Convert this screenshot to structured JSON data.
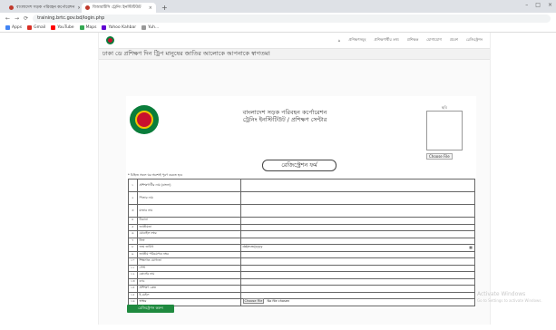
{
  "browser": {
    "tabs": [
      {
        "label": "বাংলাদেশ সড়ক পরিবহন কর্পোরেশন",
        "active": false
      },
      {
        "label": "বিআরটিসি ট্রেনিং ইনস্টিটিউট",
        "active": true
      }
    ],
    "new_tab": "+",
    "window_controls": [
      "–",
      "□",
      "×"
    ],
    "nav_buttons": [
      "←",
      "→",
      "⟳"
    ],
    "url": "training.brtc.gov.bd/login.php",
    "bookmarks": [
      {
        "label": "Apps",
        "icon": "apps-icon",
        "color": "#4285f4"
      },
      {
        "label": "Gmail",
        "icon": "gmail-icon",
        "color": "#d93025"
      },
      {
        "label": "YouTube",
        "icon": "youtube-icon",
        "color": "#ff0000"
      },
      {
        "label": "Maps",
        "icon": "maps-icon",
        "color": "#34a853"
      },
      {
        "label": "Yahoo Kahbar",
        "icon": "yahoo-icon",
        "color": "#6001d2"
      },
      {
        "label": "Yuh...",
        "icon": "bookmark-icon",
        "color": "#999999"
      }
    ]
  },
  "site": {
    "nav_links": [
      "প্রশিক্ষণসমূহ",
      "প্রশিক্ষণার্থীর তথ্য",
      "প্রশিক্ষক",
      "যোগাযোগ",
      "প্রবেশ",
      "রেজিস্ট্রেশন"
    ],
    "marquee": "ঢাকা ডে প্রশিক্ষণ দিন ট্রিপ মানুষের জাতির আলোকে আপনাকে স্বাগতম!",
    "heading_line1": "বাংলাদেশ সড়ক পরিবহন কর্পোরেশন",
    "heading_line2": "ট্রেনিং ইনস্টিটিউট / প্রশিক্ষণ সেন্টার",
    "photo_label": "ছবি",
    "choose_file": "Choose File",
    "card_title": "রেজিস্ট্রেশন ফর্ম",
    "form_note": "* চিহ্নিত সকল ঘর অবশ্যই পূরণ করতে হবে",
    "rows": [
      {
        "n": "১",
        "label": "প্রশিক্ষণার্থীর নাম (বাংলা)",
        "value": "",
        "tall": true
      },
      {
        "n": "২",
        "label": "পিতার নাম",
        "value": "",
        "tall": true
      },
      {
        "n": "৩",
        "label": "মাতার নাম",
        "value": "",
        "tall": true
      },
      {
        "n": "৪",
        "label": "ঠিকানা",
        "value": "",
        "tall": false
      },
      {
        "n": "৫",
        "label": "জাতীয়তা",
        "value": "",
        "tall": false
      },
      {
        "n": "৬",
        "label": "মোবাইল নম্বর",
        "value": "",
        "tall": false
      },
      {
        "n": "৭",
        "label": "লিঙ্গ",
        "value": "",
        "tall": false
      },
      {
        "n": "৮",
        "label": "জন্ম তারিখ",
        "value": "dd/mm/yyyy",
        "tall": false,
        "calendar": true
      },
      {
        "n": "৯",
        "label": "জাতীয় পরিচয়পত্র নম্বর",
        "value": "",
        "tall": false
      },
      {
        "n": "১০",
        "label": "শিক্ষাগত যোগ্যতা",
        "value": "",
        "tall": false
      },
      {
        "n": "১১",
        "label": "পেশা",
        "value": "",
        "tall": false
      },
      {
        "n": "১২",
        "label": "কোর্সের নাম",
        "value": "",
        "tall": false
      },
      {
        "n": "১৩",
        "label": "ব্যাচ",
        "value": "",
        "tall": false
      },
      {
        "n": "১৪",
        "label": "প্রশিক্ষণ কেন্দ্র",
        "value": "",
        "tall": false
      },
      {
        "n": "১৫",
        "label": "ই-মেইল",
        "value": "",
        "tall": false
      },
      {
        "n": "১৬",
        "label": "স্বাক্ষর",
        "value": "No file chosen",
        "tall": false,
        "file": true
      }
    ],
    "submit_label": "রেজিস্ট্রেশন করুন"
  },
  "watermark": {
    "line1": "Activate Windows",
    "line2": "Go to Settings to activate Windows."
  }
}
